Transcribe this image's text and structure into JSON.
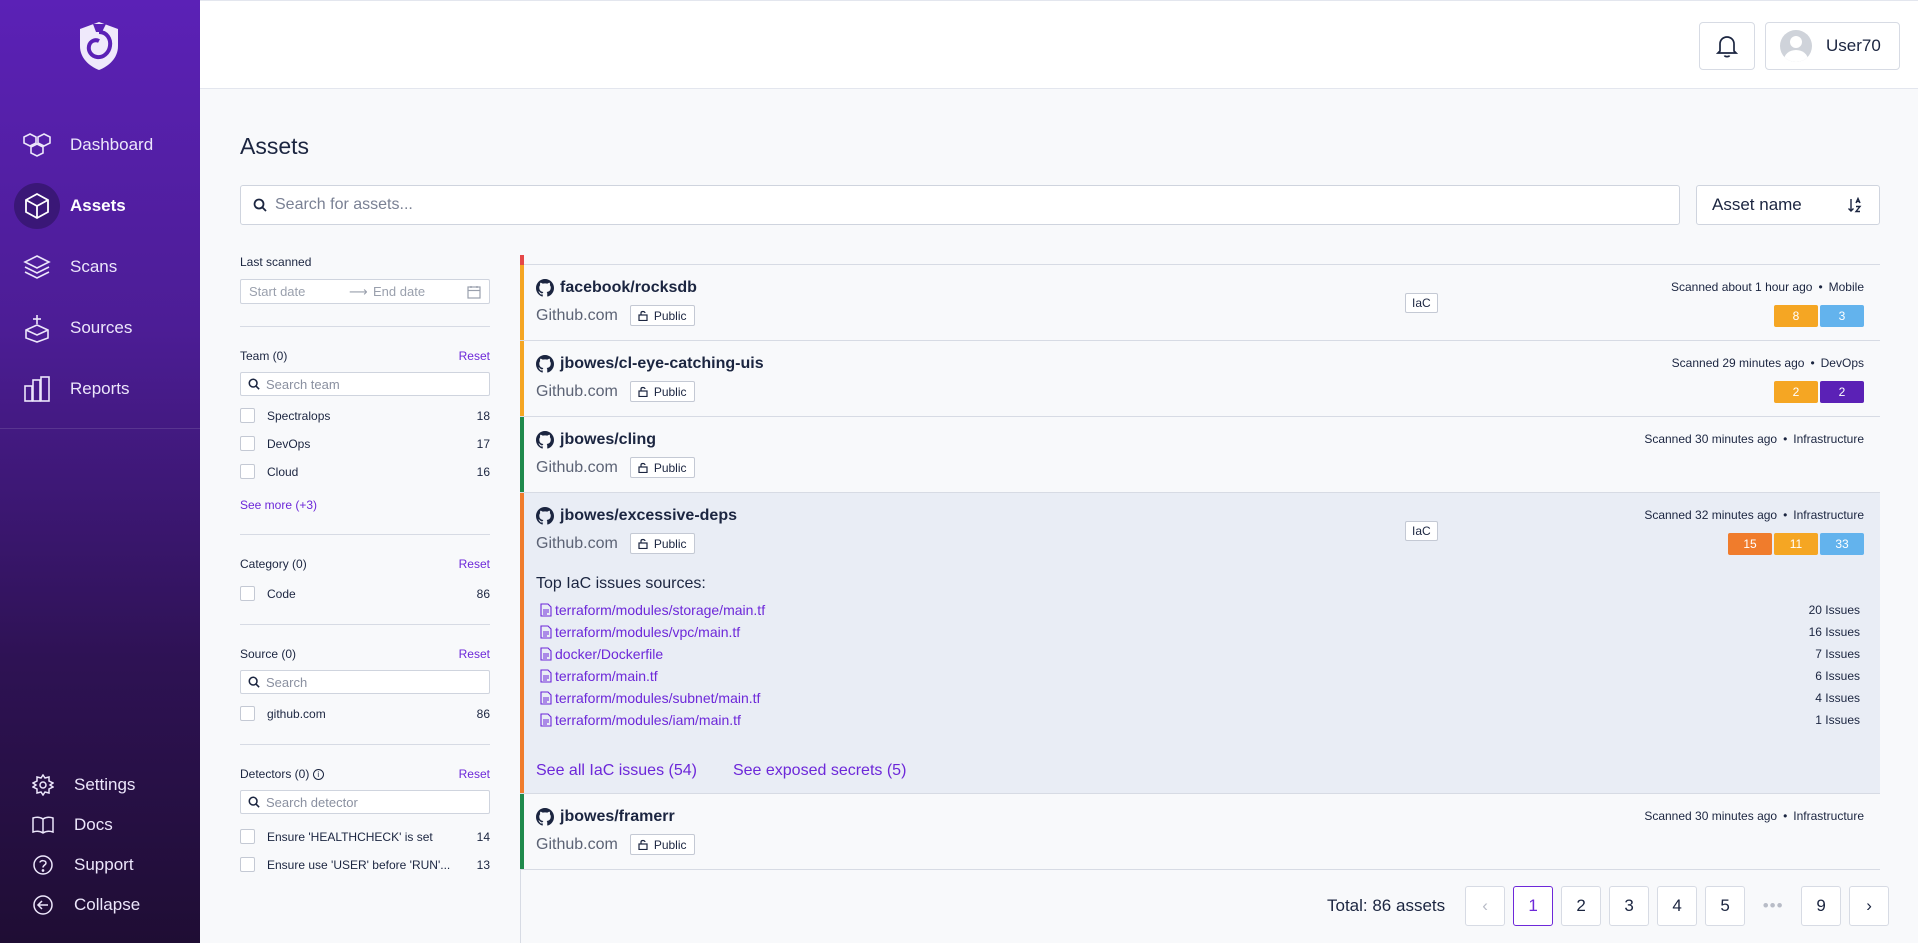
{
  "sidebar": {
    "items": [
      {
        "label": "Dashboard",
        "icon": "dashboard-icon"
      },
      {
        "label": "Assets",
        "icon": "cube-icon"
      },
      {
        "label": "Scans",
        "icon": "layers-icon"
      },
      {
        "label": "Sources",
        "icon": "source-icon"
      },
      {
        "label": "Reports",
        "icon": "reports-icon"
      }
    ],
    "active": "Assets",
    "bottom": [
      {
        "label": "Settings",
        "icon": "gear-icon"
      },
      {
        "label": "Docs",
        "icon": "book-icon"
      },
      {
        "label": "Support",
        "icon": "help-icon"
      },
      {
        "label": "Collapse",
        "icon": "collapse-icon"
      }
    ]
  },
  "header": {
    "user": "User70"
  },
  "page": {
    "title": "Assets"
  },
  "search": {
    "placeholder": "Search for assets..."
  },
  "sort": {
    "label": "Asset name"
  },
  "filters": {
    "last_scanned": {
      "label": "Last scanned",
      "start_placeholder": "Start date",
      "end_placeholder": "End date"
    },
    "team": {
      "label": "Team (0)",
      "reset": "Reset",
      "search_placeholder": "Search team",
      "items": [
        {
          "name": "Spectralops",
          "count": "18"
        },
        {
          "name": "DevOps",
          "count": "17"
        },
        {
          "name": "Cloud",
          "count": "16"
        }
      ],
      "see_more": "See more (+3)"
    },
    "category": {
      "label": "Category (0)",
      "reset": "Reset",
      "items": [
        {
          "name": "Code",
          "count": "86"
        }
      ]
    },
    "source": {
      "label": "Source (0)",
      "reset": "Reset",
      "search_placeholder": "Search",
      "items": [
        {
          "name": "github.com",
          "count": "86"
        }
      ]
    },
    "detectors": {
      "label": "Detectors (0)",
      "reset": "Reset",
      "search_placeholder": "Search detector",
      "items": [
        {
          "name": "Ensure 'HEALTHCHECK' is set",
          "count": "14"
        },
        {
          "name": "Ensure use 'USER' before 'RUN'...",
          "count": "13"
        }
      ]
    }
  },
  "assets": [
    {
      "name": "facebook/rocksdb",
      "host": "Github.com",
      "visibility": "Public",
      "tag": "IaC",
      "scanned": "Scanned about 1 hour ago",
      "team": "Mobile",
      "bar_color": "#f5a623",
      "badges": [
        {
          "value": "8",
          "color": "#f5a623"
        },
        {
          "value": "3",
          "color": "#63b3ed"
        }
      ]
    },
    {
      "name": "jbowes/cl-eye-catching-uis",
      "host": "Github.com",
      "visibility": "Public",
      "tag": "",
      "scanned": "Scanned 29 minutes ago",
      "team": "DevOps",
      "bar_color": "#f5a623",
      "badges": [
        {
          "value": "2",
          "color": "#f5a623"
        },
        {
          "value": "2",
          "color": "#5b21b6"
        }
      ]
    },
    {
      "name": "jbowes/cling",
      "host": "Github.com",
      "visibility": "Public",
      "tag": "",
      "scanned": "Scanned 30 minutes ago",
      "team": "Infrastructure",
      "bar_color": "#1f8a4c",
      "badges": []
    },
    {
      "name": "jbowes/excessive-deps",
      "host": "Github.com",
      "visibility": "Public",
      "tag": "IaC",
      "scanned": "Scanned 32 minutes ago",
      "team": "Infrastructure",
      "bar_color": "#f07c2c",
      "badges": [
        {
          "value": "15",
          "color": "#f07c2c"
        },
        {
          "value": "11",
          "color": "#f5a623"
        },
        {
          "value": "33",
          "color": "#63b3ed"
        }
      ],
      "expanded": {
        "title": "Top IaC issues sources:",
        "sources": [
          {
            "file": "terraform/modules/storage/main.tf",
            "count": "20 Issues"
          },
          {
            "file": "terraform/modules/vpc/main.tf",
            "count": "16 Issues"
          },
          {
            "file": "docker/Dockerfile",
            "count": "7 Issues"
          },
          {
            "file": "terraform/main.tf",
            "count": "6 Issues"
          },
          {
            "file": "terraform/modules/subnet/main.tf",
            "count": "4 Issues"
          },
          {
            "file": "terraform/modules/iam/main.tf",
            "count": "1 Issues"
          }
        ],
        "link_iac": "See all IaC issues (54)",
        "link_secrets": "See exposed secrets (5)"
      }
    },
    {
      "name": "jbowes/framerr",
      "host": "Github.com",
      "visibility": "Public",
      "tag": "",
      "scanned": "Scanned 30 minutes ago",
      "team": "Infrastructure",
      "bar_color": "#1f8a4c",
      "badges": []
    }
  ],
  "pagination": {
    "total": "Total: 86 assets",
    "pages": [
      "1",
      "2",
      "3",
      "4",
      "5"
    ],
    "ellipsis": "•••",
    "last": "9",
    "current": "1",
    "prev": "‹",
    "next": "›"
  },
  "colors": {
    "accent": "#6d28d9",
    "sidebar": "#5b21b6"
  }
}
